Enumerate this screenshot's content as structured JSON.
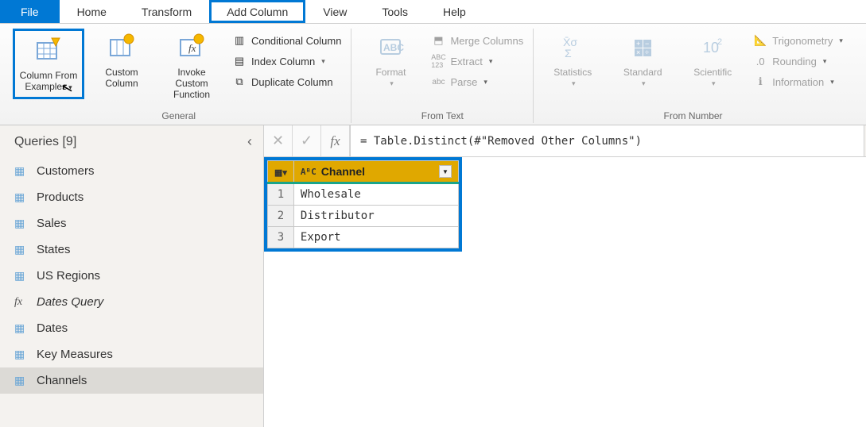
{
  "menu": {
    "file": "File",
    "home": "Home",
    "transform": "Transform",
    "add_column": "Add Column",
    "view": "View",
    "tools": "Tools",
    "help": "Help"
  },
  "ribbon": {
    "general": {
      "label": "General",
      "col_from_examples_l1": "Column From",
      "col_from_examples_l2": "Examples",
      "custom_col_l1": "Custom",
      "custom_col_l2": "Column",
      "invoke_l1": "Invoke Custom",
      "invoke_l2": "Function",
      "conditional": "Conditional Column",
      "index": "Index Column",
      "duplicate": "Duplicate Column"
    },
    "from_text": {
      "label": "From Text",
      "format_l1": "Format",
      "merge": "Merge Columns",
      "extract": "Extract",
      "parse": "Parse"
    },
    "from_number": {
      "label": "From Number",
      "statistics_l1": "Statistics",
      "standard_l1": "Standard",
      "scientific_l1": "Scientific",
      "trig": "Trigonometry",
      "rounding": "Rounding",
      "info": "Information"
    }
  },
  "queries": {
    "title": "Queries [9]",
    "items": [
      {
        "label": "Customers",
        "icon": "table"
      },
      {
        "label": "Products",
        "icon": "table"
      },
      {
        "label": "Sales",
        "icon": "table"
      },
      {
        "label": "States",
        "icon": "table"
      },
      {
        "label": "US Regions",
        "icon": "table"
      },
      {
        "label": "Dates Query",
        "icon": "fx"
      },
      {
        "label": "Dates",
        "icon": "table"
      },
      {
        "label": "Key Measures",
        "icon": "table"
      },
      {
        "label": "Channels",
        "icon": "table"
      }
    ],
    "selected_index": 8
  },
  "formula": "= Table.Distinct(#\"Removed Other Columns\")",
  "grid": {
    "column": {
      "name": "Channel",
      "type_icon": "AᴮC"
    },
    "rows": [
      "Wholesale",
      "Distributor",
      "Export"
    ]
  }
}
